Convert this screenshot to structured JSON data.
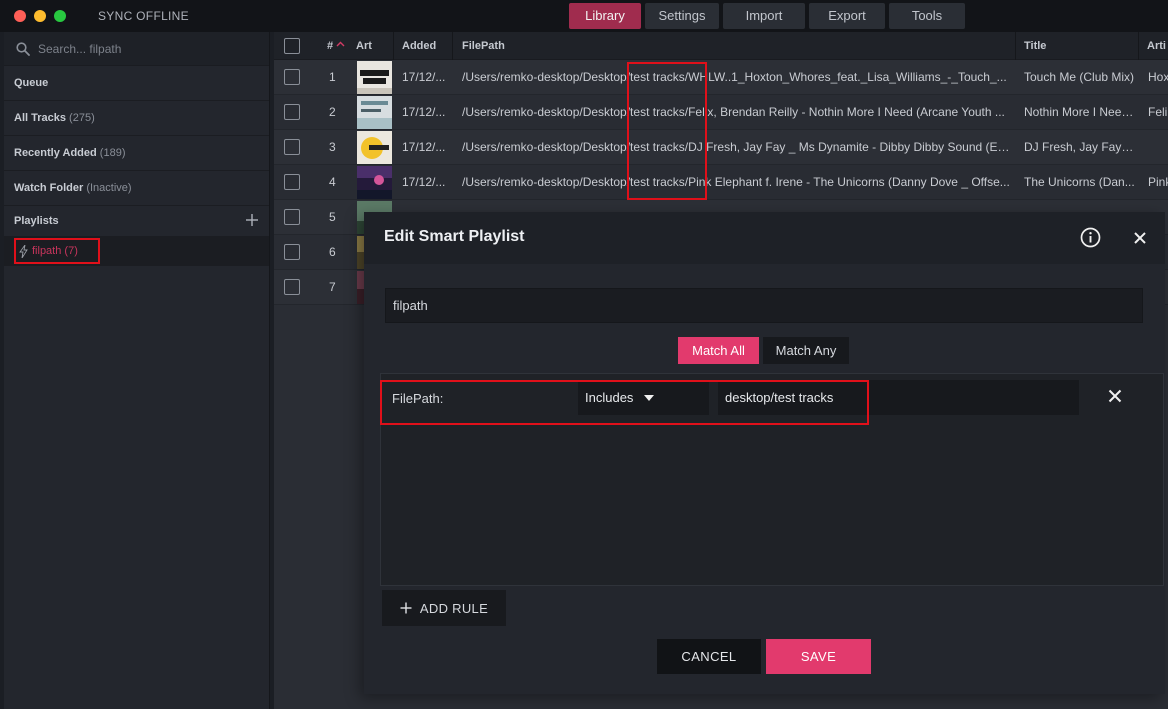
{
  "app": {
    "title": "SYNC OFFLINE"
  },
  "nav": {
    "tabs": [
      {
        "label": "Library",
        "active": true
      },
      {
        "label": "Settings"
      },
      {
        "label": "Import"
      },
      {
        "label": "Export"
      },
      {
        "label": "Tools"
      }
    ]
  },
  "sidebar": {
    "search_placeholder": "Search... filpath",
    "items": [
      {
        "label": "Queue",
        "count": ""
      },
      {
        "label": "All Tracks",
        "count": "(275)"
      },
      {
        "label": "Recently Added",
        "count": "(189)"
      },
      {
        "label": "Watch Folder",
        "count": "(Inactive)"
      }
    ],
    "playlists_label": "Playlists",
    "playlist": {
      "label": "filpath (7)"
    }
  },
  "table": {
    "headers": {
      "num": "#",
      "art": "Art",
      "added": "Added",
      "filepath": "FilePath",
      "title": "Title",
      "artist": "Arti"
    },
    "rows": [
      {
        "num": "1",
        "added": "17/12/...",
        "filepath": "/Users/remko-desktop/Desktop/test tracks/WHLW..1_Hoxton_Whores_feat._Lisa_Williams_-_Touch_...",
        "title": "Touch Me (Club Mix)",
        "artist": "Hox"
      },
      {
        "num": "2",
        "added": "17/12/...",
        "filepath": "/Users/remko-desktop/Desktop/test tracks/Felix, Brendan Reilly - Nothin More I Need (Arcane Youth ...",
        "title": "Nothin More I Need...",
        "artist": "Feli"
      },
      {
        "num": "3",
        "added": "17/12/...",
        "filepath": "/Users/remko-desktop/Desktop/test tracks/DJ Fresh, Jay Fay _ Ms Dynamite - Dibby Dibby Sound (Ext...",
        "title": "DJ Fresh, Jay Fay & ...",
        "artist": ""
      },
      {
        "num": "4",
        "added": "17/12/...",
        "filepath": "/Users/remko-desktop/Desktop/test tracks/Pink Elephant f. Irene - The Unicorns (Danny Dove _ Offse...",
        "title": "The Unicorns (Dan...",
        "artist": "Pink"
      },
      {
        "num": "5",
        "added": "",
        "filepath": "",
        "title": "",
        "artist": ""
      },
      {
        "num": "6",
        "added": "",
        "filepath": "",
        "title": "",
        "artist": ""
      },
      {
        "num": "7",
        "added": "",
        "filepath": "",
        "title": "",
        "artist": ""
      }
    ]
  },
  "modal": {
    "title": "Edit Smart Playlist",
    "name_value": "filpath",
    "match_all": "Match All",
    "match_any": "Match Any",
    "rule": {
      "field": "FilePath:",
      "operator": "Includes",
      "value": "desktop/test tracks"
    },
    "add_rule": "ADD RULE",
    "cancel": "CANCEL",
    "save": "SAVE"
  },
  "colors": {
    "accent": "#e23a6d",
    "active_tab": "#a02c4e",
    "highlight": "#e0101a"
  }
}
